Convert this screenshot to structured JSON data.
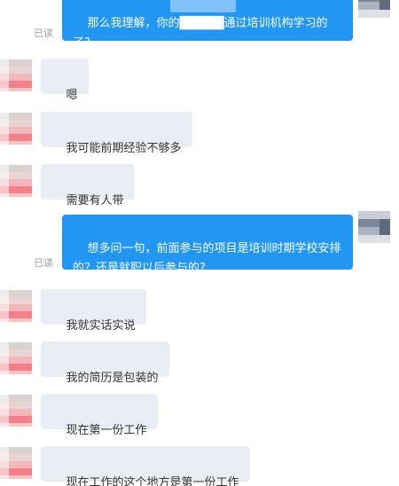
{
  "messages": [
    {
      "dir": "out",
      "text": "那么我理解，你的█████通过培训机构学习的了?",
      "read": "已读"
    },
    {
      "dir": "in",
      "text": "嗯"
    },
    {
      "dir": "in",
      "text": "我可能前期经验不够多"
    },
    {
      "dir": "in",
      "text": "需要有人带"
    },
    {
      "dir": "out",
      "text": "想多问一句，前面参与的项目是培训时期学校安排的？还是就职以后参与的?",
      "read": "已读"
    },
    {
      "dir": "in",
      "text": "我就实话实说"
    },
    {
      "dir": "in",
      "text": "我的简历是包装的"
    },
    {
      "dir": "in",
      "text": "现在第一份工作"
    },
    {
      "dir": "in",
      "text": "现在工作的这个地方是第一份工作"
    }
  ]
}
